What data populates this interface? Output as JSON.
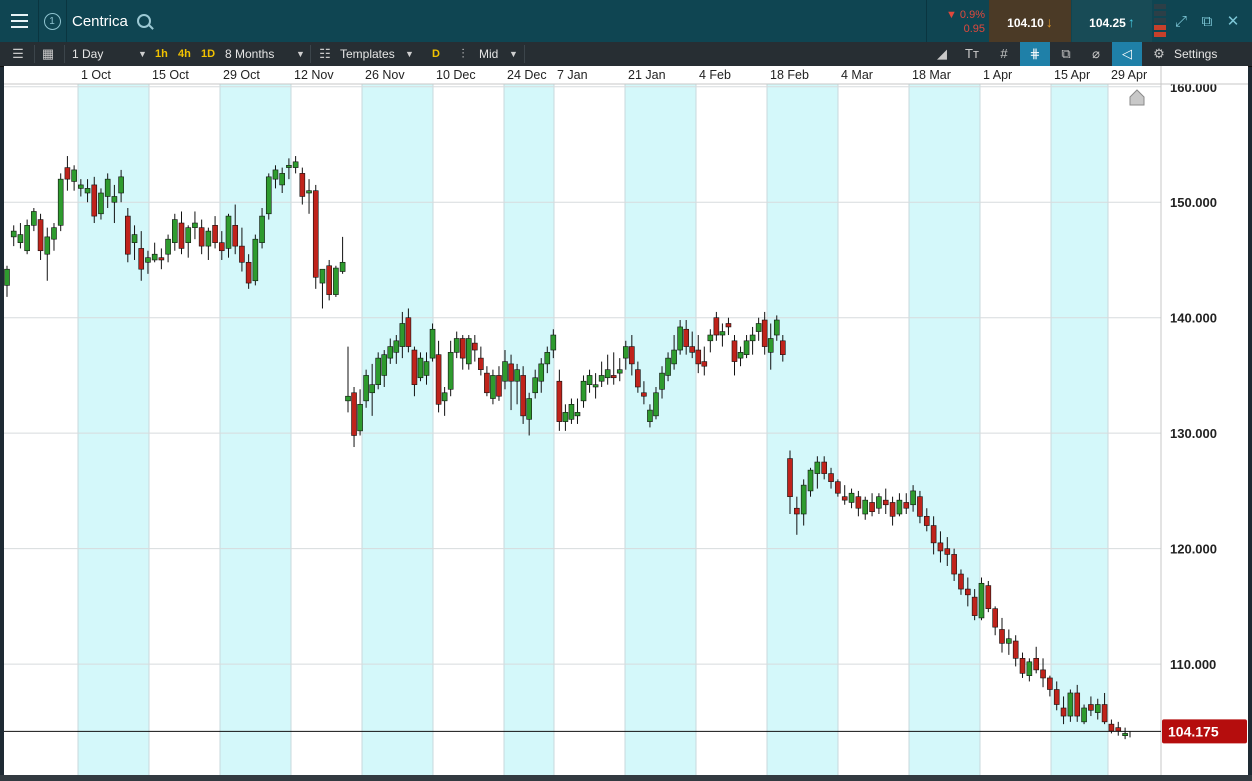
{
  "app": {
    "title": "Centrica",
    "window_number": "1",
    "change_pct": "▼ 0.9%",
    "change_abs": "0.95",
    "sell_price": "104.10",
    "buy_price": "104.25",
    "colors": {
      "up": "#2e9b2e",
      "down": "#c0231b",
      "band": "#d4f8fa",
      "price_tag": "#b50d0d"
    }
  },
  "toolbar": {
    "interval": "1 Day",
    "quick_1h": "1h",
    "quick_4h": "4h",
    "quick_1d": "1D",
    "range": "8 Months",
    "templates": "Templates",
    "d_badge": "D",
    "price_type": "Mid",
    "settings": "Settings"
  },
  "chart_data": {
    "type": "candlestick",
    "title": "Centrica",
    "xlabel": "",
    "ylabel": "",
    "x_ticks": [
      "1 Oct",
      "15 Oct",
      "29 Oct",
      "12 Nov",
      "26 Nov",
      "10 Dec",
      "24 Dec",
      "7 Jan",
      "21 Jan",
      "4 Feb",
      "18 Feb",
      "4 Mar",
      "18 Mar",
      "1 Apr",
      "15 Apr",
      "29 Apr"
    ],
    "y_ticks": [
      "160.000",
      "150.000",
      "140.000",
      "130.000",
      "120.000",
      "110.000"
    ],
    "ylim": [
      100.5,
      160.5
    ],
    "current_price": "104.175",
    "grid": true,
    "series": [
      {
        "ohlc": [
          [
            142.8,
            144.5,
            141.8,
            144.2
          ],
          [
            147.0,
            148.0,
            146.2,
            147.5
          ],
          [
            146.5,
            148.2,
            146.0,
            147.2
          ],
          [
            145.8,
            148.5,
            145.5,
            148.0
          ],
          [
            148.0,
            149.5,
            147.5,
            149.2
          ],
          [
            148.5,
            149.0,
            145.0,
            145.8
          ],
          [
            145.5,
            147.8,
            143.2,
            147.0
          ],
          [
            146.8,
            148.2,
            145.8,
            147.8
          ],
          [
            148.0,
            152.5,
            147.5,
            152.0
          ],
          [
            153.0,
            154.0,
            151.0,
            152.0
          ],
          [
            151.8,
            153.2,
            151.0,
            152.8
          ],
          [
            151.2,
            152.0,
            150.5,
            151.5
          ],
          [
            150.8,
            152.0,
            150.0,
            151.2
          ],
          [
            151.5,
            152.2,
            148.2,
            148.8
          ],
          [
            149.0,
            151.2,
            148.5,
            150.8
          ],
          [
            150.5,
            152.5,
            149.5,
            152.0
          ],
          [
            150.0,
            151.5,
            148.2,
            150.5
          ],
          [
            150.8,
            152.8,
            150.0,
            152.2
          ],
          [
            148.8,
            149.5,
            144.8,
            145.5
          ],
          [
            146.5,
            148.0,
            145.0,
            147.2
          ],
          [
            146.0,
            147.5,
            143.2,
            144.2
          ],
          [
            144.8,
            145.8,
            143.8,
            145.2
          ],
          [
            145.0,
            146.5,
            144.8,
            145.5
          ],
          [
            145.2,
            146.0,
            144.2,
            145.0
          ],
          [
            145.5,
            147.2,
            144.8,
            146.8
          ],
          [
            146.5,
            149.0,
            145.8,
            148.5
          ],
          [
            148.2,
            149.2,
            145.5,
            146.0
          ],
          [
            146.5,
            148.0,
            145.2,
            147.8
          ],
          [
            147.8,
            149.2,
            146.8,
            148.2
          ],
          [
            147.8,
            148.5,
            145.5,
            146.2
          ],
          [
            146.2,
            147.8,
            145.0,
            147.5
          ],
          [
            148.0,
            148.8,
            146.0,
            146.5
          ],
          [
            146.5,
            147.5,
            145.0,
            145.8
          ],
          [
            146.0,
            149.0,
            145.2,
            148.8
          ],
          [
            148.0,
            149.8,
            145.5,
            146.2
          ],
          [
            146.2,
            147.8,
            144.0,
            144.8
          ],
          [
            144.8,
            145.5,
            142.5,
            143.0
          ],
          [
            143.2,
            147.2,
            142.8,
            146.8
          ],
          [
            146.5,
            149.5,
            146.0,
            148.8
          ],
          [
            149.0,
            152.5,
            148.5,
            152.2
          ],
          [
            152.0,
            153.2,
            151.2,
            152.8
          ],
          [
            151.5,
            153.0,
            150.8,
            152.5
          ],
          [
            153.0,
            153.8,
            152.0,
            153.2
          ],
          [
            153.0,
            154.0,
            152.5,
            153.5
          ],
          [
            152.5,
            153.0,
            149.8,
            150.5
          ],
          [
            150.8,
            152.0,
            149.0,
            151.0
          ],
          [
            151.0,
            151.5,
            142.5,
            143.5
          ],
          [
            143.0,
            144.2,
            140.8,
            144.2
          ],
          [
            144.5,
            145.0,
            141.5,
            142.0
          ],
          [
            142.0,
            144.5,
            141.8,
            144.3
          ],
          [
            144.0,
            147.0,
            143.8,
            144.8
          ],
          [
            132.8,
            137.5,
            131.8,
            133.2
          ],
          [
            133.5,
            134.0,
            128.8,
            129.8
          ],
          [
            130.2,
            133.8,
            129.8,
            132.5
          ],
          [
            132.8,
            135.5,
            132.2,
            135.0
          ],
          [
            133.5,
            136.0,
            131.5,
            134.2
          ],
          [
            134.2,
            137.0,
            133.8,
            136.5
          ],
          [
            135.0,
            137.2,
            134.0,
            136.8
          ],
          [
            136.5,
            138.2,
            136.0,
            137.5
          ],
          [
            137.0,
            138.5,
            136.0,
            138.0
          ],
          [
            137.5,
            140.5,
            136.5,
            139.5
          ],
          [
            140.0,
            140.8,
            137.0,
            137.5
          ],
          [
            137.2,
            137.5,
            133.2,
            134.2
          ],
          [
            134.8,
            137.0,
            134.5,
            136.5
          ],
          [
            135.0,
            137.0,
            134.2,
            136.2
          ],
          [
            136.5,
            139.5,
            136.2,
            139.0
          ],
          [
            136.8,
            138.0,
            131.8,
            132.5
          ],
          [
            132.8,
            134.0,
            131.5,
            133.5
          ],
          [
            133.8,
            138.0,
            133.2,
            137.0
          ],
          [
            137.0,
            138.8,
            136.5,
            138.2
          ],
          [
            138.2,
            138.5,
            135.5,
            136.5
          ],
          [
            136.0,
            138.5,
            135.5,
            138.2
          ],
          [
            137.8,
            138.5,
            136.2,
            137.2
          ],
          [
            136.5,
            137.5,
            135.0,
            135.5
          ],
          [
            135.2,
            135.8,
            133.2,
            133.5
          ],
          [
            133.0,
            135.5,
            132.5,
            135.0
          ],
          [
            135.0,
            135.8,
            132.8,
            133.2
          ],
          [
            134.5,
            137.2,
            133.8,
            136.2
          ],
          [
            136.0,
            136.8,
            132.0,
            134.5
          ],
          [
            134.5,
            136.0,
            132.5,
            135.5
          ],
          [
            135.0,
            135.8,
            130.8,
            131.5
          ],
          [
            131.2,
            133.5,
            129.8,
            133.0
          ],
          [
            133.5,
            135.5,
            133.0,
            134.8
          ],
          [
            134.5,
            136.5,
            133.5,
            136.0
          ],
          [
            136.0,
            137.5,
            135.2,
            137.0
          ],
          [
            137.2,
            139.0,
            136.5,
            138.5
          ],
          [
            134.5,
            135.5,
            130.2,
            131.0
          ],
          [
            131.0,
            132.5,
            130.2,
            131.8
          ],
          [
            131.2,
            133.0,
            130.8,
            132.5
          ],
          [
            131.5,
            133.0,
            130.8,
            131.8
          ],
          [
            132.8,
            135.0,
            132.2,
            134.5
          ],
          [
            134.2,
            135.5,
            133.5,
            135.0
          ],
          [
            134.0,
            135.2,
            133.0,
            134.2
          ],
          [
            134.5,
            136.2,
            134.0,
            135.0
          ],
          [
            134.8,
            136.8,
            134.2,
            135.5
          ],
          [
            135.0,
            137.0,
            134.2,
            134.8
          ],
          [
            135.2,
            136.5,
            134.5,
            135.5
          ],
          [
            136.5,
            138.0,
            135.5,
            137.5
          ],
          [
            137.5,
            138.5,
            135.0,
            136.0
          ],
          [
            135.5,
            136.2,
            133.5,
            134.0
          ],
          [
            133.5,
            134.5,
            132.5,
            133.2
          ],
          [
            131.0,
            132.5,
            130.5,
            132.0
          ],
          [
            131.5,
            134.0,
            131.2,
            133.5
          ],
          [
            133.8,
            135.8,
            133.0,
            135.2
          ],
          [
            135.0,
            137.0,
            134.5,
            136.5
          ],
          [
            136.0,
            138.5,
            135.5,
            137.2
          ],
          [
            137.2,
            139.8,
            136.8,
            139.2
          ],
          [
            139.0,
            139.8,
            136.8,
            137.5
          ],
          [
            137.5,
            138.8,
            136.5,
            137.0
          ],
          [
            137.2,
            138.5,
            135.2,
            136.0
          ],
          [
            136.2,
            137.5,
            135.0,
            135.8
          ],
          [
            138.0,
            139.0,
            137.0,
            138.5
          ],
          [
            140.0,
            140.5,
            138.0,
            138.5
          ],
          [
            138.5,
            139.5,
            137.5,
            138.8
          ],
          [
            139.5,
            140.0,
            138.5,
            139.2
          ],
          [
            138.0,
            138.5,
            135.0,
            136.2
          ],
          [
            136.5,
            137.5,
            135.8,
            137.0
          ],
          [
            136.8,
            138.5,
            136.5,
            138.0
          ],
          [
            138.0,
            139.2,
            136.8,
            138.5
          ],
          [
            138.8,
            140.0,
            138.0,
            139.5
          ],
          [
            139.8,
            140.5,
            136.8,
            137.5
          ],
          [
            137.0,
            139.5,
            135.5,
            138.2
          ],
          [
            138.5,
            140.2,
            138.0,
            139.8
          ],
          [
            138.0,
            138.5,
            136.2,
            136.8
          ],
          [
            127.8,
            128.5,
            123.0,
            124.5
          ],
          [
            123.5,
            124.5,
            121.2,
            123.0
          ],
          [
            123.0,
            126.0,
            122.0,
            125.5
          ],
          [
            125.0,
            127.0,
            124.5,
            126.8
          ],
          [
            126.5,
            128.0,
            125.2,
            127.5
          ],
          [
            127.5,
            128.0,
            126.0,
            126.5
          ],
          [
            126.5,
            127.0,
            125.2,
            125.8
          ],
          [
            125.8,
            126.0,
            124.5,
            124.8
          ],
          [
            124.5,
            125.5,
            123.8,
            124.2
          ],
          [
            124.0,
            125.2,
            123.5,
            124.8
          ],
          [
            124.5,
            125.0,
            122.8,
            123.5
          ],
          [
            123.0,
            124.5,
            122.5,
            124.2
          ],
          [
            124.0,
            124.8,
            122.8,
            123.2
          ],
          [
            123.5,
            124.8,
            123.0,
            124.5
          ],
          [
            124.2,
            125.2,
            123.0,
            123.8
          ],
          [
            124.0,
            124.5,
            122.0,
            122.8
          ],
          [
            123.0,
            124.8,
            122.8,
            124.2
          ],
          [
            124.0,
            124.8,
            123.0,
            123.5
          ],
          [
            123.8,
            125.5,
            123.2,
            125.0
          ],
          [
            124.5,
            125.0,
            122.2,
            122.8
          ],
          [
            122.8,
            123.5,
            121.5,
            122.0
          ],
          [
            122.0,
            122.8,
            119.5,
            120.5
          ],
          [
            120.5,
            121.5,
            118.8,
            119.8
          ],
          [
            120.0,
            121.0,
            118.5,
            119.5
          ],
          [
            119.5,
            120.0,
            117.2,
            117.8
          ],
          [
            117.8,
            118.2,
            116.0,
            116.5
          ],
          [
            116.5,
            117.5,
            115.0,
            116.0
          ],
          [
            115.8,
            116.5,
            113.8,
            114.2
          ],
          [
            114.0,
            117.5,
            113.8,
            117.0
          ],
          [
            116.8,
            117.2,
            114.5,
            114.8
          ],
          [
            114.8,
            115.0,
            112.5,
            113.2
          ],
          [
            113.0,
            114.0,
            111.0,
            111.8
          ],
          [
            111.8,
            113.0,
            110.8,
            112.2
          ],
          [
            112.0,
            112.5,
            109.8,
            110.5
          ],
          [
            110.5,
            111.0,
            108.8,
            109.2
          ],
          [
            109.0,
            110.5,
            108.5,
            110.2
          ],
          [
            110.5,
            111.5,
            109.2,
            109.5
          ],
          [
            109.5,
            110.5,
            108.0,
            108.8
          ],
          [
            108.8,
            109.0,
            107.2,
            107.8
          ],
          [
            107.8,
            108.5,
            106.0,
            106.5
          ],
          [
            106.2,
            107.2,
            104.8,
            105.5
          ],
          [
            105.5,
            107.8,
            105.0,
            107.5
          ],
          [
            107.5,
            108.2,
            105.0,
            105.5
          ],
          [
            105.0,
            106.5,
            104.8,
            106.2
          ],
          [
            106.5,
            107.2,
            105.5,
            106.0
          ],
          [
            105.8,
            107.0,
            105.2,
            106.5
          ],
          [
            106.5,
            107.5,
            104.8,
            105.0
          ],
          [
            104.8,
            105.2,
            104.0,
            104.2
          ],
          [
            104.5,
            105.0,
            103.8,
            104.2
          ],
          [
            103.8,
            104.5,
            103.5,
            104.0
          ]
        ]
      }
    ]
  }
}
